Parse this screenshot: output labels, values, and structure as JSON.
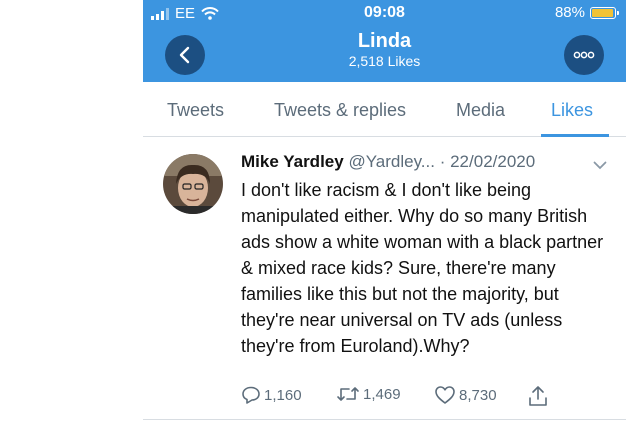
{
  "status_bar": {
    "carrier": "EE",
    "time": "09:08",
    "battery_percent": "88%",
    "battery_level": 0.88
  },
  "header": {
    "title": "Linda",
    "subtitle": "2,518 Likes"
  },
  "tabs": [
    {
      "label": "Tweets",
      "active": false
    },
    {
      "label": "Tweets & replies",
      "active": false
    },
    {
      "label": "Media",
      "active": false
    },
    {
      "label": "Likes",
      "active": true
    }
  ],
  "tweet": {
    "name": "Mike Yardley",
    "handle": "@Yardley...",
    "date": "· 22/02/2020",
    "text": "I don't like racism & I don't like being manipulated either. Why do so many British ads show a white woman with a black partner & mixed race kids? Sure, there're many families like this but not the majority, but they're near universal on TV ads (unless they're from Euroland).Why?",
    "replies": "1,160",
    "retweets": "1,469",
    "likes": "8,730"
  },
  "colors": {
    "accent": "#3c95e0",
    "button_bg": "#1c4f82",
    "muted": "#5c6c7a"
  }
}
